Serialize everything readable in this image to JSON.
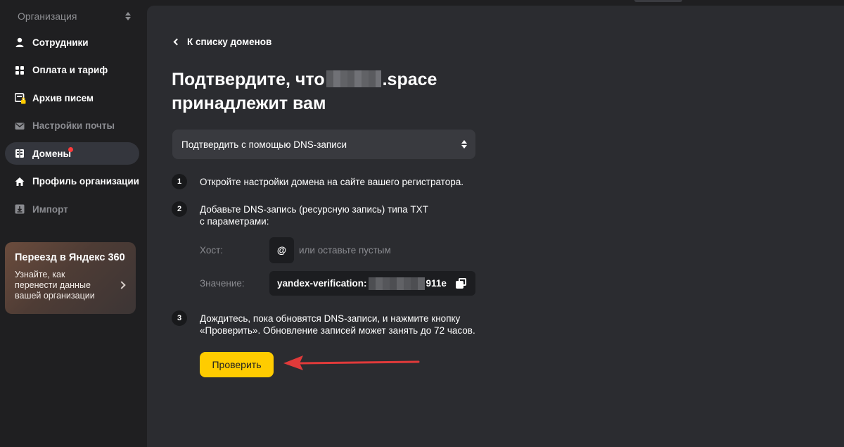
{
  "sidebar": {
    "org_label": "Организация",
    "items": [
      {
        "label": "Сотрудники",
        "icon": "person-icon"
      },
      {
        "label": "Оплата и тариф",
        "icon": "grid-icon"
      },
      {
        "label": "Архив писем",
        "icon": "archive-lock-icon"
      },
      {
        "label": "Настройки почты",
        "icon": "mail-icon"
      },
      {
        "label": "Домены",
        "icon": "domains-icon"
      },
      {
        "label": "Профиль организации",
        "icon": "home-icon"
      },
      {
        "label": "Импорт",
        "icon": "import-icon"
      }
    ],
    "promo": {
      "title": "Переезд в Яндекс 360",
      "text": "Узнайте, как перенести данные вашей организации"
    }
  },
  "main": {
    "back_label": "К списку доменов",
    "title_part1": "Подтвердите, что",
    "title_part2": ".space",
    "title_part3": "принадлежит вам",
    "method_select": "Подтвердить с помощью DNS-записи",
    "steps": [
      {
        "num": "1",
        "text": "Откройте настройки домена на сайте вашего регистратора."
      },
      {
        "num": "2",
        "line1": "Добавьте DNS-запись (ресурсную запись) типа TXT",
        "line2": "с параметрами:"
      },
      {
        "num": "3",
        "line1": "Дождитесь, пока обновятся DNS-записи, и нажмите кнопку",
        "line2": "«Проверить». Обновление записей может занять до 72 часов."
      }
    ],
    "host_label": "Хост:",
    "host_value": "@",
    "host_hint": "или оставьте пустым",
    "value_label": "Значение:",
    "value_prefix": "yandex-verification:",
    "value_suffix": "911e",
    "check_button": "Проверить"
  },
  "colors": {
    "accent_button": "#ffcc00",
    "arrow": "#e03a3a",
    "notification_dot": "#ff3b3b"
  }
}
